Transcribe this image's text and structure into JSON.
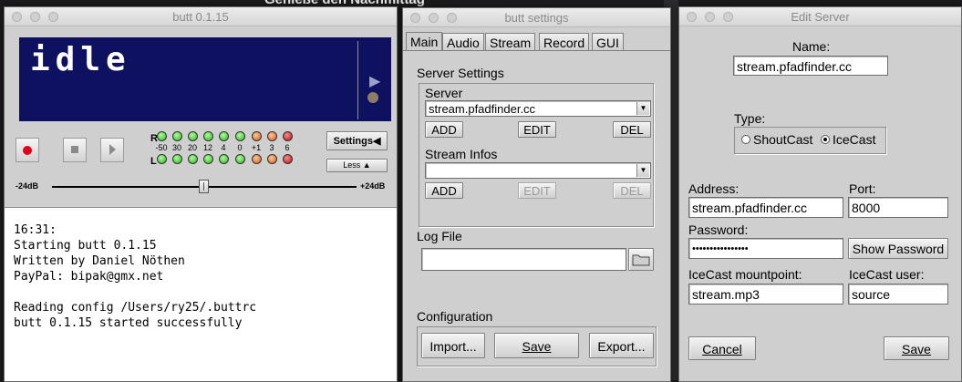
{
  "background": {
    "banner_text": "Genieße den Nachmittag"
  },
  "main_window": {
    "title": "butt 0.1.15",
    "display_text": "idle",
    "vu": {
      "left_label": "R",
      "right_label": "L",
      "scale": [
        "-50",
        "30",
        "20",
        "12",
        "4",
        "0",
        "+1",
        "3",
        "6"
      ]
    },
    "settings_button": "Settings",
    "less_button": "Less",
    "gain_min_label": "-24dB",
    "gain_max_label": "+24dB",
    "gain_value_db": 0,
    "log_lines": [
      "16:31:",
      "Starting butt 0.1.15",
      "Written by Daniel Nöthen",
      "PayPal: bipak@gmx.net",
      "",
      "Reading config /Users/ry25/.buttrc",
      "butt 0.1.15 started successfully"
    ]
  },
  "settings_window": {
    "title": "butt settings",
    "tabs": [
      "Main",
      "Audio",
      "Stream",
      "Record",
      "GUI"
    ],
    "active_tab": "Main",
    "server_settings_label": "Server Settings",
    "server_label": "Server",
    "server_value": "stream.pfadfinder.cc",
    "add_label": "ADD",
    "edit_label": "EDIT",
    "del_label": "DEL",
    "stream_infos_label": "Stream Infos",
    "stream_infos_value": "",
    "log_file_label": "Log File",
    "log_file_value": "",
    "configuration_label": "Configuration",
    "import_label": "Import...",
    "save_label": "Save",
    "export_label": "Export..."
  },
  "edit_server": {
    "title": "Edit Server",
    "name_label": "Name:",
    "name_value": "stream.pfadfinder.cc",
    "type_label": "Type:",
    "type_options": [
      "ShoutCast",
      "IceCast"
    ],
    "type_selected": "IceCast",
    "address_label": "Address:",
    "address_value": "stream.pfadfinder.cc",
    "port_label": "Port:",
    "port_value": "8000",
    "password_label": "Password:",
    "password_value": "••••••••••••••••",
    "show_password_label": "Show Password",
    "mountpoint_label": "IceCast mountpoint:",
    "mountpoint_value": "stream.mp3",
    "user_label": "IceCast user:",
    "user_value": "source",
    "cancel_label": "Cancel",
    "save_label": "Save"
  }
}
